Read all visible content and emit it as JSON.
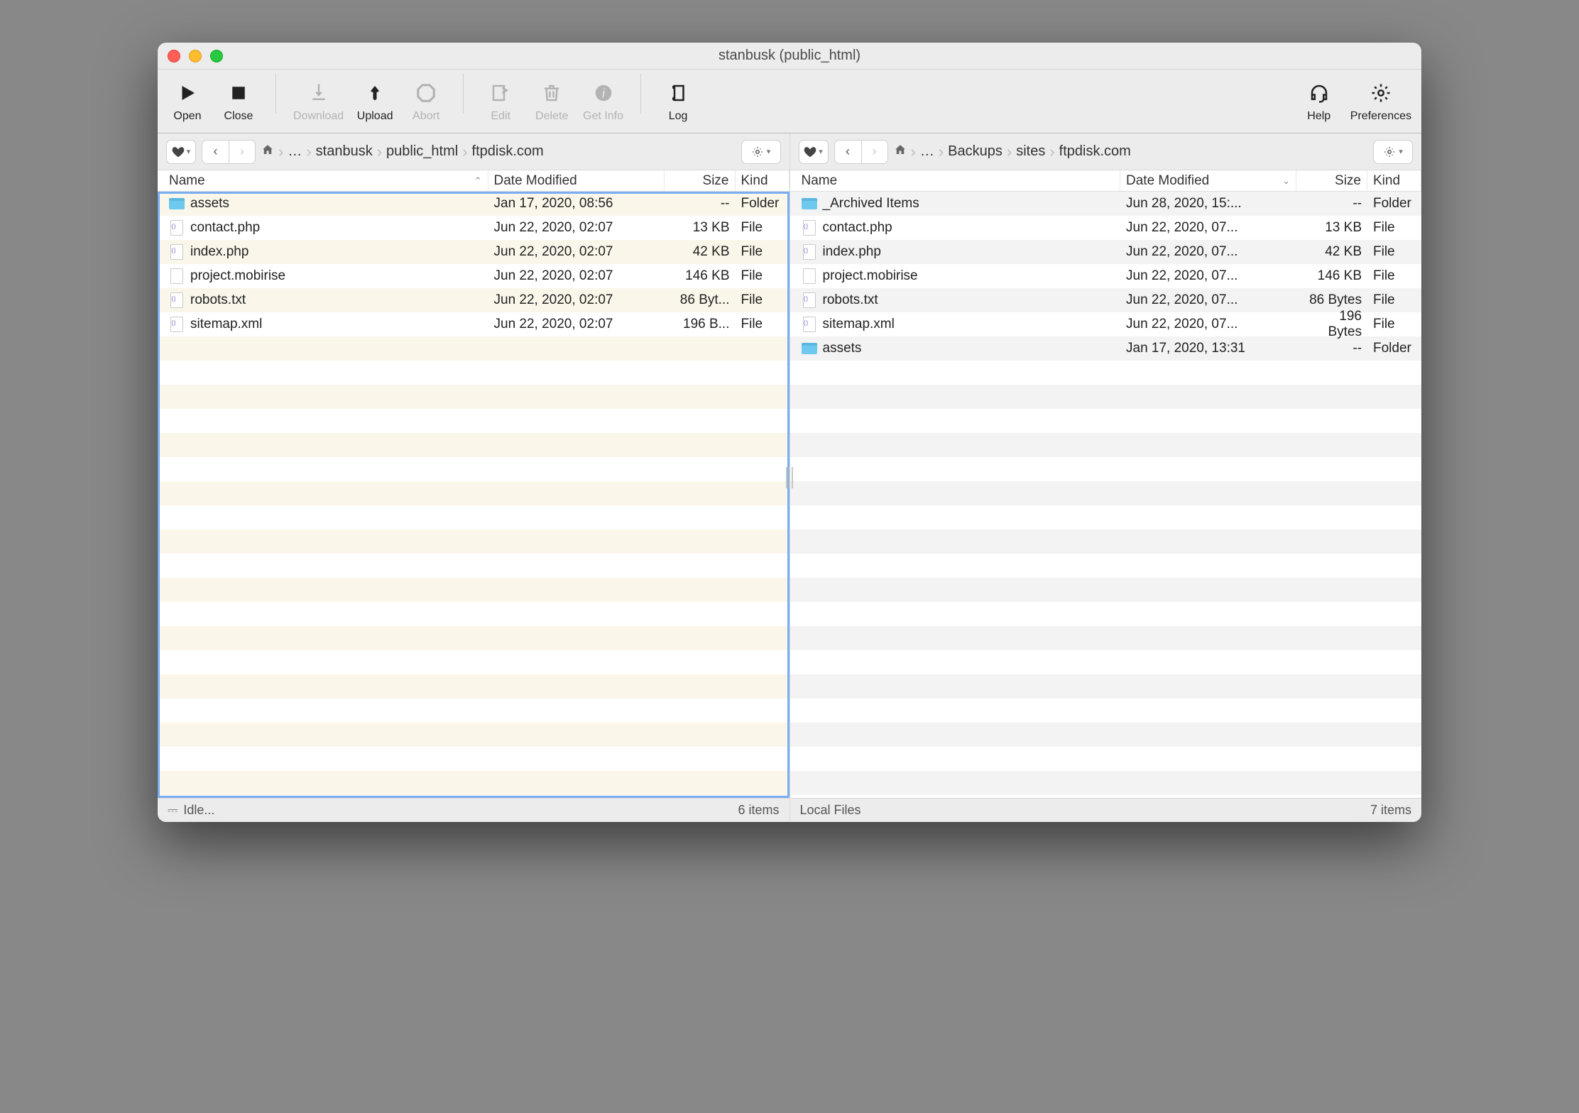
{
  "window": {
    "title": "stanbusk (public_html)"
  },
  "toolbar": {
    "open": "Open",
    "close": "Close",
    "download": "Download",
    "upload": "Upload",
    "abort": "Abort",
    "edit": "Edit",
    "delete": "Delete",
    "getinfo": "Get Info",
    "log": "Log",
    "help": "Help",
    "preferences": "Preferences"
  },
  "left": {
    "breadcrumbs": [
      "…",
      "stanbusk",
      "public_html",
      "ftpdisk.com"
    ],
    "columns": {
      "name": "Name",
      "date": "Date Modified",
      "size": "Size",
      "kind": "Kind"
    },
    "files": [
      {
        "name": "assets",
        "date": "Jan 17, 2020, 08:56",
        "size": "--",
        "kind": "Folder",
        "icon": "folder"
      },
      {
        "name": "contact.php",
        "date": "Jun 22, 2020, 02:07",
        "size": "13 KB",
        "kind": "File",
        "icon": "php"
      },
      {
        "name": "index.php",
        "date": "Jun 22, 2020, 02:07",
        "size": "42 KB",
        "kind": "File",
        "icon": "php"
      },
      {
        "name": "project.mobirise",
        "date": "Jun 22, 2020, 02:07",
        "size": "146 KB",
        "kind": "File",
        "icon": "file"
      },
      {
        "name": "robots.txt",
        "date": "Jun 22, 2020, 02:07",
        "size": "86 Byt...",
        "kind": "File",
        "icon": "txt"
      },
      {
        "name": "sitemap.xml",
        "date": "Jun 22, 2020, 02:07",
        "size": "196 B...",
        "kind": "File",
        "icon": "xml"
      }
    ],
    "status_left": "Idle...",
    "status_right": "6 items"
  },
  "right": {
    "breadcrumbs": [
      "…",
      "Backups",
      "sites",
      "ftpdisk.com"
    ],
    "columns": {
      "name": "Name",
      "date": "Date Modified",
      "size": "Size",
      "kind": "Kind"
    },
    "files": [
      {
        "name": "_Archived Items",
        "date": "Jun 28, 2020, 15:...",
        "size": "--",
        "kind": "Folder",
        "icon": "folder"
      },
      {
        "name": "contact.php",
        "date": "Jun 22, 2020, 07...",
        "size": "13 KB",
        "kind": "File",
        "icon": "php"
      },
      {
        "name": "index.php",
        "date": "Jun 22, 2020, 07...",
        "size": "42 KB",
        "kind": "File",
        "icon": "php"
      },
      {
        "name": "project.mobirise",
        "date": "Jun 22, 2020, 07...",
        "size": "146 KB",
        "kind": "File",
        "icon": "file"
      },
      {
        "name": "robots.txt",
        "date": "Jun 22, 2020, 07...",
        "size": "86 Bytes",
        "kind": "File",
        "icon": "txt"
      },
      {
        "name": "sitemap.xml",
        "date": "Jun 22, 2020, 07...",
        "size": "196 Bytes",
        "kind": "File",
        "icon": "xml"
      },
      {
        "name": "assets",
        "date": "Jan 17, 2020, 13:31",
        "size": "--",
        "kind": "Folder",
        "icon": "folder"
      }
    ],
    "status_left": "Local Files",
    "status_right": "7 items"
  }
}
